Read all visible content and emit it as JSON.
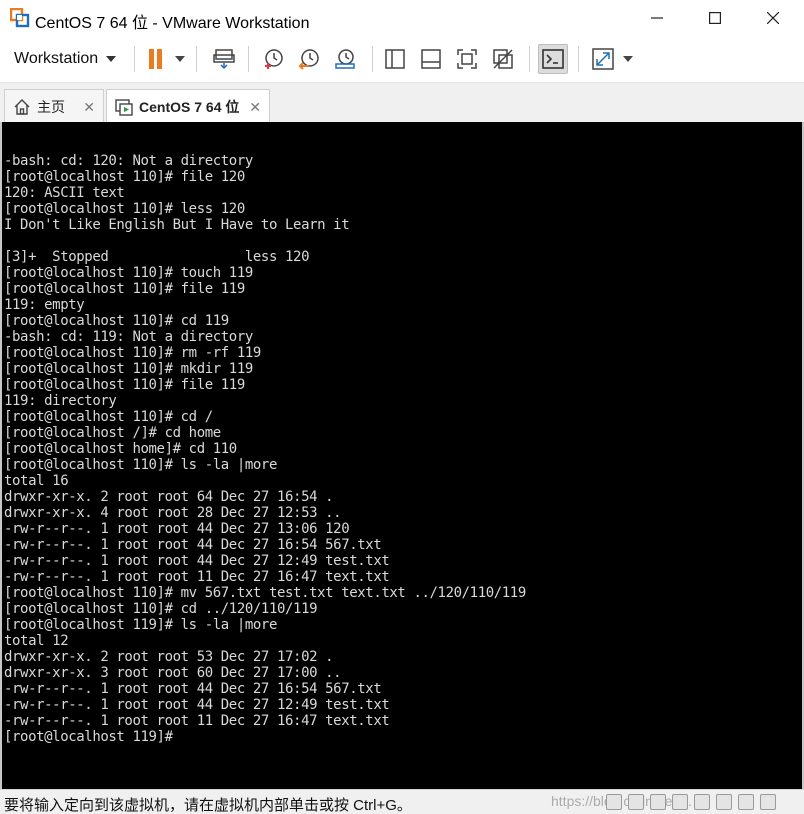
{
  "window": {
    "title": "CentOS 7 64 位 - VMware Workstation",
    "app_icon": "vmware-logo-icon",
    "controls": [
      "minimize-icon",
      "maximize-icon",
      "close-icon"
    ]
  },
  "toolbar": {
    "menu_label": "Workstation",
    "buttons": [
      "pause-icon",
      "send-ctrl-alt-del-icon",
      "snapshot-take-icon",
      "snapshot-revert-icon",
      "snapshot-manager-icon",
      "show-library-icon",
      "thumbnail-bar-icon",
      "fullscreen-icon",
      "unity-icon",
      "console-view-icon",
      "stretch-guest-icon"
    ]
  },
  "tabs": [
    {
      "label": "主页",
      "icon": "home-icon",
      "active": false
    },
    {
      "label": "CentOS 7 64 位",
      "icon": "vm-icon",
      "active": true
    }
  ],
  "console": {
    "lines": [
      "-bash: cd: 120: Not a directory",
      "[root@localhost 110]# file 120",
      "120: ASCII text",
      "[root@localhost 110]# less 120",
      "I Don't Like English But I Have to Learn it",
      "",
      "[3]+  Stopped                 less 120",
      "[root@localhost 110]# touch 119",
      "[root@localhost 110]# file 119",
      "119: empty",
      "[root@localhost 110]# cd 119",
      "-bash: cd: 119: Not a directory",
      "[root@localhost 110]# rm -rf 119",
      "[root@localhost 110]# mkdir 119",
      "[root@localhost 110]# file 119",
      "119: directory",
      "[root@localhost 110]# cd /",
      "[root@localhost /]# cd home",
      "[root@localhost home]# cd 110",
      "[root@localhost 110]# ls -la |more",
      "total 16",
      "drwxr-xr-x. 2 root root 64 Dec 27 16:54 .",
      "drwxr-xr-x. 4 root root 28 Dec 27 12:53 ..",
      "-rw-r--r--. 1 root root 44 Dec 27 13:06 120",
      "-rw-r--r--. 1 root root 44 Dec 27 16:54 567.txt",
      "-rw-r--r--. 1 root root 44 Dec 27 12:49 test.txt",
      "-rw-r--r--. 1 root root 11 Dec 27 16:47 text.txt",
      "[root@localhost 110]# mv 567.txt test.txt text.txt ../120/110/119",
      "[root@localhost 110]# cd ../120/110/119",
      "[root@localhost 119]# ls -la |more",
      "total 12",
      "drwxr-xr-x. 2 root root 53 Dec 27 17:02 .",
      "drwxr-xr-x. 3 root root 60 Dec 27 17:00 ..",
      "-rw-r--r--. 1 root root 44 Dec 27 16:54 567.txt",
      "-rw-r--r--. 1 root root 44 Dec 27 12:49 test.txt",
      "-rw-r--r--. 1 root root 11 Dec 27 16:47 text.txt",
      "[root@localhost 119]#"
    ]
  },
  "statusbar": {
    "message": "要将输入定向到该虚拟机，请在虚拟机内部单击或按 Ctrl+G。",
    "watermark": "https://blog.csdn.net/...",
    "icons": [
      "hard-disk-icon",
      "cd-dvd-icon",
      "network-icon",
      "usb-icon",
      "printer-icon",
      "sound-icon",
      "display-icon",
      "message-icon"
    ]
  },
  "colors": {
    "console_bg": "#000000",
    "console_fg": "#d9d9d9",
    "pause_orange": "#ee7a1f",
    "accent_blue": "#1e6fb8"
  }
}
